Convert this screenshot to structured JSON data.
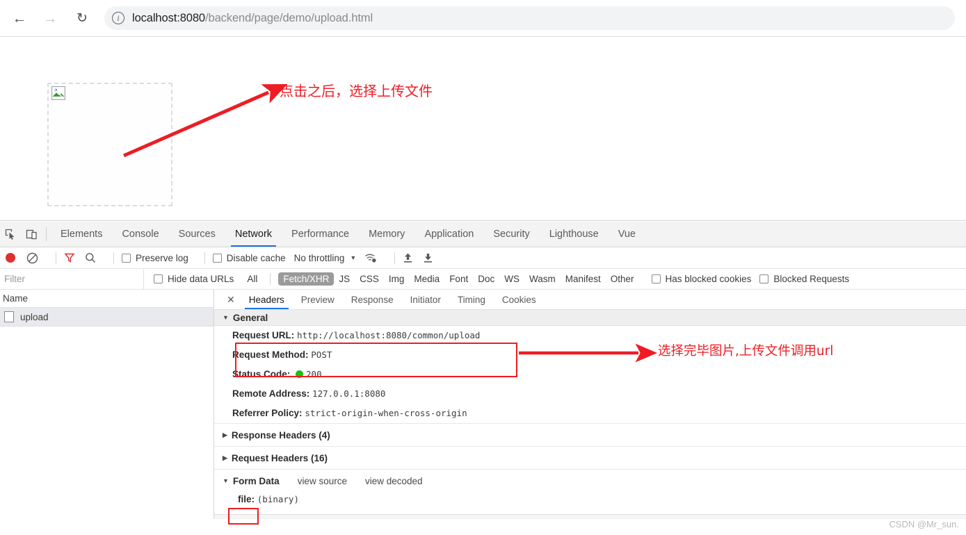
{
  "browser": {
    "back_icon": "arrow-left-icon",
    "forward_icon": "arrow-right-icon",
    "reload_icon": "reload-icon",
    "info_icon": "info-circle-icon",
    "url_scheme": "localhost:8080",
    "url_path": "/backend/page/demo/upload.html",
    "url_full": "localhost:8080/backend/page/demo/upload.html"
  },
  "page": {
    "upload_box_name": "image-upload-dropzone",
    "broken_image_icon": "broken-image-icon"
  },
  "annotations": {
    "note1": "点击之后，选择上传文件",
    "note2": "选择完毕图片,上传文件调用url",
    "accent_color": "#ef1c24",
    "highlight_box_color": "#f01c1c"
  },
  "watermark": "CSDN @Mr_sun.",
  "devtools": {
    "inspect_icon": "inspect-element-icon",
    "device_icon": "device-toolbar-icon",
    "tabs": [
      {
        "label": "Elements",
        "active": false
      },
      {
        "label": "Console",
        "active": false
      },
      {
        "label": "Sources",
        "active": false
      },
      {
        "label": "Network",
        "active": true
      },
      {
        "label": "Performance",
        "active": false
      },
      {
        "label": "Memory",
        "active": false
      },
      {
        "label": "Application",
        "active": false
      },
      {
        "label": "Security",
        "active": false
      },
      {
        "label": "Lighthouse",
        "active": false
      },
      {
        "label": "Vue",
        "active": false
      }
    ],
    "toolbar": {
      "record_icon": "record-stop-icon",
      "clear_icon": "clear-network-log-icon",
      "filter_icon": "filter-funnel-icon",
      "search_icon": "search-icon",
      "preserve_log": "Preserve log",
      "disable_cache": "Disable cache",
      "throttling": "No throttling",
      "throttle_caret": "chevron-down-icon",
      "wifi_icon": "network-conditions-icon",
      "import_icon": "import-har-icon",
      "export_icon": "export-har-icon"
    },
    "filterbar": {
      "filter_placeholder": "Filter",
      "hide_data_urls": "Hide data URLs",
      "types": [
        {
          "label": "All",
          "selected": false
        },
        {
          "label": "Fetch/XHR",
          "selected": true
        },
        {
          "label": "JS",
          "selected": false
        },
        {
          "label": "CSS",
          "selected": false
        },
        {
          "label": "Img",
          "selected": false
        },
        {
          "label": "Media",
          "selected": false
        },
        {
          "label": "Font",
          "selected": false
        },
        {
          "label": "Doc",
          "selected": false
        },
        {
          "label": "WS",
          "selected": false
        },
        {
          "label": "Wasm",
          "selected": false
        },
        {
          "label": "Manifest",
          "selected": false
        },
        {
          "label": "Other",
          "selected": false
        }
      ],
      "has_blocked_cookies": "Has blocked cookies",
      "blocked_requests": "Blocked Requests"
    },
    "request_list": {
      "column_header": "Name",
      "rows": [
        {
          "name": "upload",
          "icon": "document-icon",
          "selected": true
        }
      ]
    },
    "detail": {
      "close_icon": "close-icon",
      "tabs": [
        {
          "label": "Headers",
          "active": true
        },
        {
          "label": "Preview",
          "active": false
        },
        {
          "label": "Response",
          "active": false
        },
        {
          "label": "Initiator",
          "active": false
        },
        {
          "label": "Timing",
          "active": false
        },
        {
          "label": "Cookies",
          "active": false
        }
      ],
      "general": {
        "title": "General",
        "items": [
          {
            "key": "Request URL:",
            "value": "http://localhost:8080/common/upload"
          },
          {
            "key": "Request Method:",
            "value": "POST"
          },
          {
            "key": "Status Code:",
            "value": "200",
            "has_status_dot": true,
            "status_color": "#19c119"
          },
          {
            "key": "Remote Address:",
            "value": "127.0.0.1:8080"
          },
          {
            "key": "Referrer Policy:",
            "value": "strict-origin-when-cross-origin"
          }
        ]
      },
      "response_headers": "Response Headers (4)",
      "request_headers": "Request Headers (16)",
      "form_data": {
        "title": "Form Data",
        "view_source": "view source",
        "view_decoded": "view decoded",
        "rows": [
          {
            "key": "file:",
            "value": "(binary)"
          }
        ]
      }
    }
  }
}
